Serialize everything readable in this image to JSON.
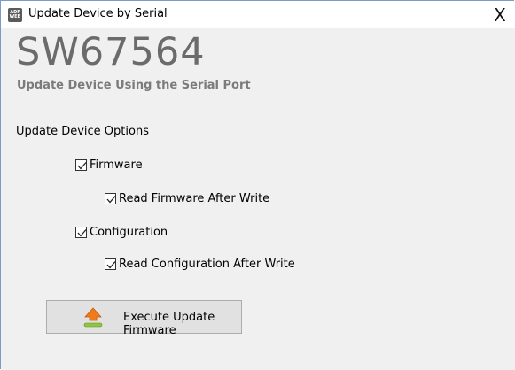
{
  "window": {
    "title": "Update Device by Serial",
    "icon_top": "ADF",
    "icon_bottom": "WEB",
    "close_label": "X"
  },
  "header": {
    "product_code": "SW67564",
    "subtitle": "Update Device Using the Serial Port"
  },
  "options": {
    "group_label": "Update Device Options",
    "items": [
      {
        "label": "Firmware",
        "checked": true
      },
      {
        "label": "Read Firmware After Write",
        "checked": true
      },
      {
        "label": "Configuration",
        "checked": true
      },
      {
        "label": "Read Configuration After Write",
        "checked": true
      }
    ]
  },
  "action": {
    "label": "Execute Update Firmware",
    "icon": "upload-arrow-icon"
  },
  "colors": {
    "background": "#f0f0f0",
    "product_code": "#6b6b6b",
    "subtitle": "#7b7b7b",
    "arrow_orange": "#f07b1a",
    "bar_green": "#8fc53f"
  }
}
